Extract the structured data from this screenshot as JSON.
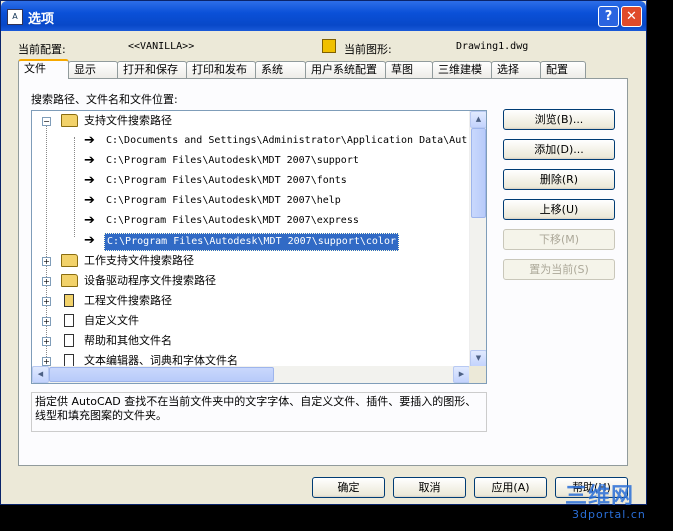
{
  "window": {
    "title": "选项",
    "app_icon_text": "A",
    "help_button": "?",
    "close_button": "✕"
  },
  "header": {
    "profile_label": "当前配置:",
    "profile_value": "<<VANILLA>>",
    "drawing_label": "当前图形:",
    "drawing_value": "Drawing1.dwg"
  },
  "tabs": [
    "文件",
    "显示",
    "打开和保存",
    "打印和发布",
    "系统",
    "用户系统配置",
    "草图",
    "三维建模",
    "选择",
    "配置"
  ],
  "section_label": "搜索路径、文件名和文件位置:",
  "tree": {
    "root": {
      "label": "支持文件搜索路径",
      "paths": [
        "C:\\Documents and Settings\\Administrator\\Application Data\\Aut",
        "C:\\Program Files\\Autodesk\\MDT 2007\\support",
        "C:\\Program Files\\Autodesk\\MDT 2007\\fonts",
        "C:\\Program Files\\Autodesk\\MDT 2007\\help",
        "C:\\Program Files\\Autodesk\\MDT 2007\\express",
        "C:\\Program Files\\Autodesk\\MDT 2007\\support\\color"
      ]
    },
    "nodes": [
      "工作支持文件搜索路径",
      "设备驱动程序文件搜索路径",
      "工程文件搜索路径",
      "自定义文件",
      "帮助和其他文件名",
      "文本编辑器、词典和字体文件名"
    ]
  },
  "description": "指定供 AutoCAD 查找不在当前文件夹中的文字字体、自定义文件、插件、要插入的图形、线型和填充图案的文件夹。",
  "side_buttons": {
    "browse": "浏览(B)...",
    "add": "添加(D)...",
    "remove": "删除(R)",
    "move_up": "上移(U)",
    "move_down": "下移(M)",
    "set_current": "置为当前(S)"
  },
  "bottom_buttons": {
    "ok": "确定",
    "cancel": "取消",
    "apply": "应用(A)",
    "help": "帮助(H)"
  },
  "watermark": {
    "logo": "三维网",
    "url": "3dportal.cn"
  }
}
